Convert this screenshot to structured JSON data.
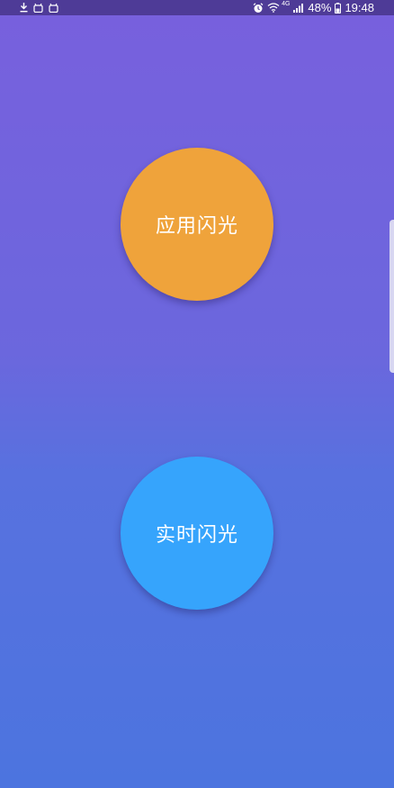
{
  "status_bar": {
    "network_type": "4G",
    "battery_percent": "48%",
    "time": "19:48",
    "left_icons": [
      "download-icon",
      "android-icon",
      "android-icon"
    ],
    "right_icons": [
      "alarm-icon",
      "wifi-icon",
      "signal-icon",
      "battery-icon"
    ]
  },
  "buttons": {
    "apply_flash": {
      "label": "应用闪光",
      "color": "#EFA33B"
    },
    "realtime_flash": {
      "label": "实时闪光",
      "color": "#36A4FC"
    }
  },
  "colors": {
    "background_top": "#7860DD",
    "background_bottom": "#4C74DF",
    "status_bar": "#4E3B97"
  }
}
